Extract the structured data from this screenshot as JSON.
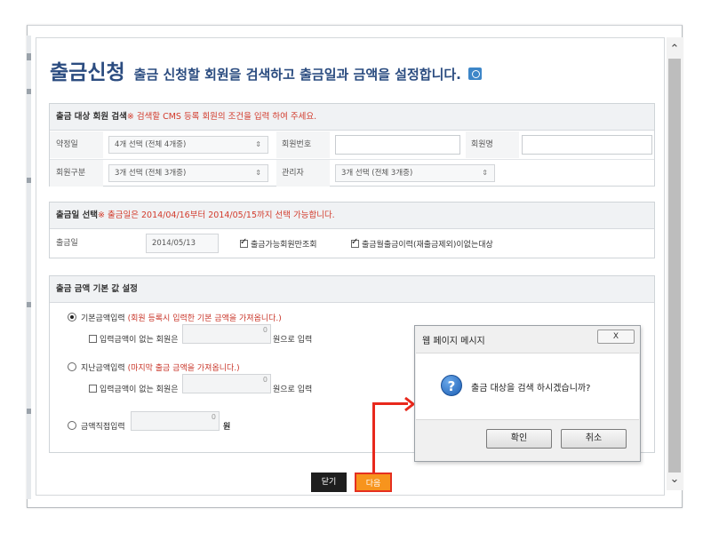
{
  "title": {
    "main": "출금신청",
    "sub": "출금 신청할 회원을 검색하고 출금일과 금액을 설정합니다."
  },
  "member_search": {
    "header": "출금 대상 회원 검색",
    "hint": "※ 검색할 CMS 등록 회원의 조건을 입력 하여 주세요.",
    "fields": {
      "contract_day_label": "약정일",
      "contract_day_value": "4개 선택 (전체 4개중)",
      "member_no_label": "회원번호",
      "member_name_label": "회원명",
      "member_type_label": "회원구분",
      "member_type_value": "3개 선택 (전체 3개중)",
      "manager_label": "관리자",
      "manager_value": "3개 선택 (전체 3개중)"
    }
  },
  "date_select": {
    "header": "출금일 선택",
    "hint": "※ 출금일은 2014/04/16부터 2014/05/15까지 선택 가능합니다.",
    "label": "출금일",
    "value": "2014/05/13",
    "check1": "출금가능회원만조회",
    "check2": "출금월출금이력(재출금제외)이없는대상"
  },
  "amount_settings": {
    "header": "출금 금액 기본 값 설정",
    "option1": "기본금액입력",
    "option1_hint": "(회원 등록시 입력한 기본 금액을 가져옵니다.)",
    "option1_check": "입력금액이 없는 회원은",
    "option1_suffix": "원으로 입력",
    "option2": "지난금액입력",
    "option2_hint": "(마지막 출금 금액을 가져옵니다.)",
    "option2_check": "입력금액이 없는 회원은",
    "option2_suffix": "원으로 입력",
    "option3": "금액직접입력",
    "option3_suffix": "원",
    "zero": "0"
  },
  "buttons": {
    "close": "닫기",
    "next": "다음"
  },
  "dialog": {
    "title": "웹 페이지 메시지",
    "message": "출금 대상을 검색 하시겠습니까?",
    "ok": "확인",
    "cancel": "취소",
    "close_symbol": "X"
  },
  "colors": {
    "title_blue": "#2b4c80",
    "hint_red": "#d23b2c",
    "next_orange": "#f7941d",
    "highlight_red": "#e8281c"
  }
}
